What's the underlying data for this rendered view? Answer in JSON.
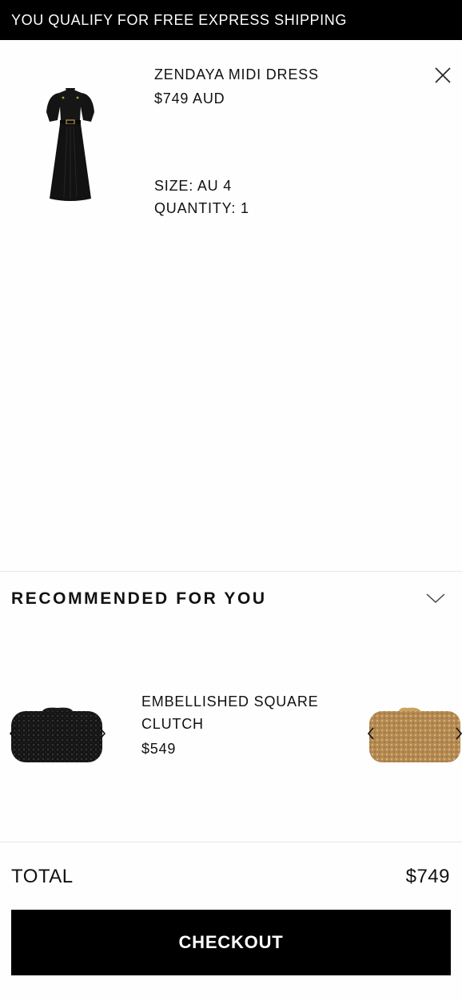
{
  "banner": {
    "text": "YOU QUALIFY FOR FREE EXPRESS SHIPPING"
  },
  "cart": {
    "item": {
      "name": "ZENDAYA MIDI DRESS",
      "price": "$749 AUD",
      "size": "SIZE: AU 4",
      "quantity": "QUANTITY: 1",
      "image_icon": "black-midi-dress",
      "remove_icon": "close-icon"
    }
  },
  "recommended": {
    "title": "RECOMMENDED FOR YOU",
    "toggle_icon": "chevron-down-icon",
    "current": {
      "name_line1": "EMBELLISHED SQUARE",
      "name_line2": "CLUTCH",
      "price": "$549"
    },
    "images": [
      "black-embellished-clutch",
      "gold-embellished-clutch"
    ]
  },
  "summary": {
    "total_label": "TOTAL",
    "total_value": "$749"
  },
  "checkout": {
    "label": "CHECKOUT"
  },
  "colors": {
    "banner_bg": "#000000",
    "button_bg": "#000000",
    "text": "#111111",
    "divider": "#e8e8e8"
  }
}
